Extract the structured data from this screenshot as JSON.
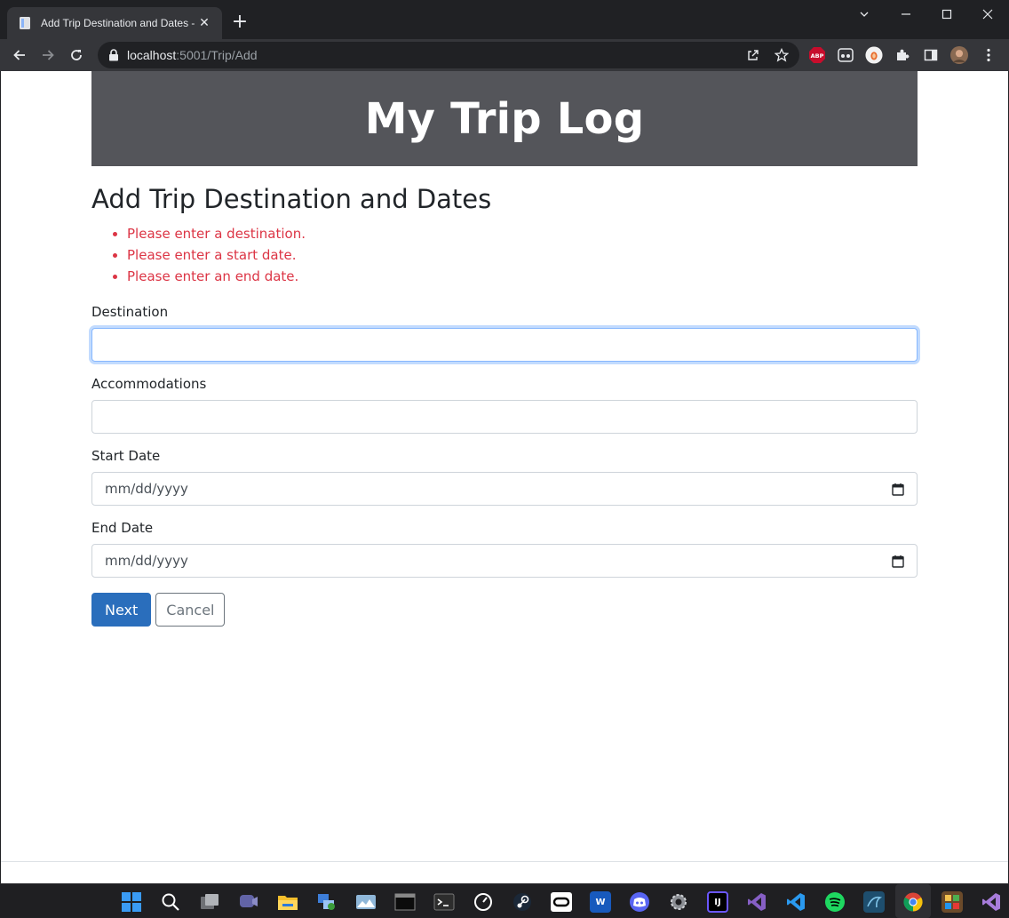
{
  "browser": {
    "tab_title": "Add Trip Destination and Dates -",
    "url_host": "localhost",
    "url_path": ":5001/Trip/Add",
    "new_tab_glyph": "+",
    "close_glyph": "✕"
  },
  "page": {
    "banner_title": "My Trip Log",
    "heading": "Add Trip Destination and Dates",
    "errors": [
      "Please enter a destination.",
      "Please enter a start date.",
      "Please enter an end date."
    ],
    "fields": {
      "destination": {
        "label": "Destination",
        "value": ""
      },
      "accommodations": {
        "label": "Accommodations",
        "value": ""
      },
      "start_date": {
        "label": "Start Date",
        "placeholder": "mm/dd/yyyy"
      },
      "end_date": {
        "label": "End Date",
        "placeholder": "mm/dd/yyyy"
      }
    },
    "buttons": {
      "next": "Next",
      "cancel": "Cancel"
    }
  },
  "extensions": {
    "abp_label": "ABP"
  },
  "taskbar": {
    "icons": [
      "start",
      "search",
      "task-view",
      "teams-chat",
      "file-explorer",
      "network-tool",
      "photos",
      "terminal-dark",
      "terminal",
      "speed",
      "steam",
      "oculus",
      "word",
      "discord",
      "settings",
      "jetbrains",
      "visual-studio",
      "vscode",
      "spotify",
      "mysql",
      "chrome",
      "app-grid",
      "visual-studio-preview"
    ],
    "jetbrains_label": "IJ",
    "word_label": "W"
  },
  "colors": {
    "banner_bg": "#54555a",
    "error_red": "#dc3545",
    "primary_blue": "#2a6ebc"
  }
}
